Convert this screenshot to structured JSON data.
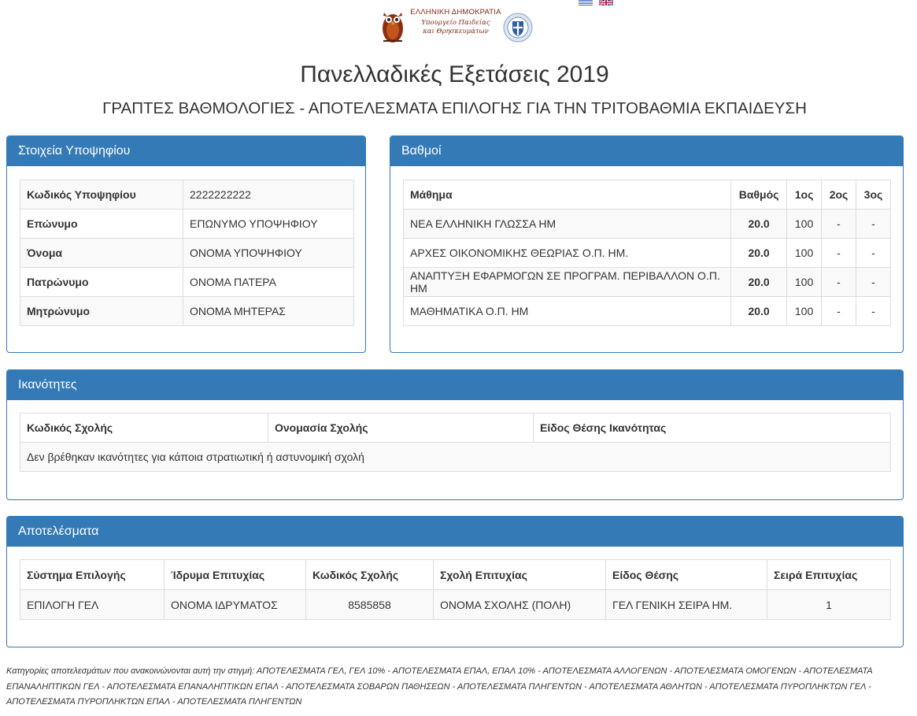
{
  "header": {
    "logo": {
      "line1": "ΕΛΛΗΝΙΚΗ ΔΗΜΟΚΡΑΤΙΑ",
      "line2": "Υπουργείο Παιδείας",
      "line3": "και Θρησκευμάτων"
    },
    "languages": [
      "greek-flag",
      "uk-flag"
    ],
    "title": "Πανελλαδικές Εξετάσεις 2019",
    "subtitle": "ΓΡΑΠΤΕΣ ΒΑΘΜΟΛΟΓΙΕΣ - ΑΠΟΤΕΛΕΣΜΑΤΑ ΕΠΙΛΟΓΗΣ ΓΙΑ ΤΗΝ ΤΡΙΤΟΒΑΘΜΙΑ ΕΚΠΑΙΔΕΥΣΗ"
  },
  "candidate": {
    "heading": "Στοιχεία Υποψηφίου",
    "rows": [
      {
        "label": "Κωδικός Υποψηφίου",
        "value": "2222222222"
      },
      {
        "label": "Επώνυμο",
        "value": "ΕΠΩΝΥΜΟ ΥΠΟΨΗΦΙΟΥ"
      },
      {
        "label": "Όνομα",
        "value": "ΟΝΟΜΑ ΥΠΟΨΗΦΙΟΥ"
      },
      {
        "label": "Πατρώνυμο",
        "value": "ΟΝΟΜΑ ΠΑΤΕΡΑ"
      },
      {
        "label": "Μητρώνυμο",
        "value": "ΟΝΟΜΑ ΜΗΤΕΡΑΣ"
      }
    ]
  },
  "grades": {
    "heading": "Βαθμοί",
    "columns": [
      "Μάθημα",
      "Βαθμός",
      "1ος",
      "2ος",
      "3ος"
    ],
    "rows": [
      {
        "subject": "ΝΕΑ ΕΛΛΗΝΙΚΗ ΓΛΩΣΣΑ ΗΜ",
        "grade": "20.0",
        "g1": "100",
        "g2": "-",
        "g3": "-"
      },
      {
        "subject": "ΑΡΧΕΣ ΟΙΚΟΝΟΜΙΚΗΣ ΘΕΩΡΙΑΣ Ο.Π. ΗΜ.",
        "grade": "20.0",
        "g1": "100",
        "g2": "-",
        "g3": "-"
      },
      {
        "subject": "ΑΝΑΠΤΥΞΗ ΕΦΑΡΜΟΓΩΝ ΣΕ ΠΡΟΓΡΑΜ. ΠΕΡΙΒΑΛΛΟΝ Ο.Π. ΗΜ",
        "grade": "20.0",
        "g1": "100",
        "g2": "-",
        "g3": "-"
      },
      {
        "subject": "ΜΑΘΗΜΑΤΙΚΑ Ο.Π. ΗΜ",
        "grade": "20.0",
        "g1": "100",
        "g2": "-",
        "g3": "-"
      }
    ]
  },
  "abilities": {
    "heading": "Ικανότητες",
    "columns": [
      "Κωδικός Σχολής",
      "Ονομασία Σχολής",
      "Είδος Θέσης Ικανότητας"
    ],
    "empty_message": "Δεν βρέθηκαν ικανότητες για κάποια στρατιωτική ή αστυνομική σχολή"
  },
  "results": {
    "heading": "Αποτελέσματα",
    "columns": [
      "Σύστημα Επιλογής",
      "Ίδρυμα Επιτυχίας",
      "Κωδικός Σχολής",
      "Σχολή Επιτυχίας",
      "Είδος Θέσης",
      "Σειρά Επιτυχίας"
    ],
    "rows": [
      {
        "system": "ΕΠΙΛΟΓΗ ΓΕΛ",
        "institution": "ΟΝΟΜΑ ΙΔΡΥΜΑΤΟΣ",
        "code": "8585858",
        "school": "ΟΝΟΜΑ ΣΧΟΛΗΣ (ΠΟΛΗ)",
        "position_type": "ΓΕΛ ΓΕΝΙΚΗ ΣΕΙΡΑ ΗΜ.",
        "rank": "1"
      }
    ]
  },
  "footnote": "Κατηγορίες αποτελεσμάτων που ανακοινώνονται αυτή την στιγμή: ΑΠΟΤΕΛΕΣΜΑΤΑ ΓΕΛ, ΓΕΛ 10% - ΑΠΟΤΕΛΕΣΜΑΤΑ ΕΠΑΛ, ΕΠΑΛ 10% - ΑΠΟΤΕΛΕΣΜΑΤΑ ΑΛΛΟΓΕΝΩΝ - ΑΠΟΤΕΛΕΣΜΑΤΑ ΟΜΟΓΕΝΩΝ - ΑΠΟΤΕΛΕΣΜΑΤΑ ΕΠΑΝΑΛΗΠΤΙΚΩΝ ΓΕΛ - ΑΠΟΤΕΛΕΣΜΑΤΑ ΕΠΑΝΑΛΗΠΤΙΚΩΝ ΕΠΑΛ - ΑΠΟΤΕΛΕΣΜΑΤΑ ΣΟΒΑΡΩΝ ΠΑΘΗΣΕΩΝ - ΑΠΟΤΕΛΕΣΜΑΤΑ ΠΛΗΓΕΝΤΩΝ - ΑΠΟΤΕΛΕΣΜΑΤΑ ΑΘΛΗΤΩΝ - ΑΠΟΤΕΛΕΣΜΑΤΑ ΠΥΡΟΠΛΗΚΤΩΝ ΓΕΛ - ΑΠΟΤΕΛΕΣΜΑΤΑ ΠΥΡΟΠΛΗΚΤΩΝ ΕΠΑΛ - ΑΠΟΤΕΛΕΣΜΑΤΑ ΠΛΗΓΕΝΤΩΝ",
  "colors": {
    "primary": "#337ab7",
    "border": "#dddddd",
    "stripe": "#f9f9f9",
    "logo_text": "#7a2b12"
  }
}
